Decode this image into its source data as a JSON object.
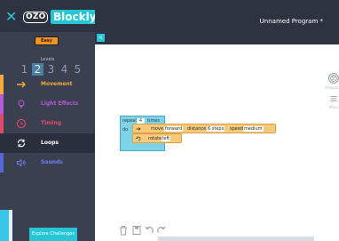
{
  "brand": {
    "x_mark": "✕",
    "ozo": "OZO",
    "blockly": "Blockly"
  },
  "level_badge": "Easy",
  "levels": {
    "label": "Levels",
    "items": [
      "1",
      "2",
      "3",
      "4",
      "5"
    ],
    "active_index": 1
  },
  "nav": [
    {
      "label": "Movement",
      "icon": "arrow-right-icon",
      "color": "#f7a83e"
    },
    {
      "label": "Light Effects",
      "icon": "lightbulb-icon",
      "color": "#b25ad8"
    },
    {
      "label": "Timing",
      "icon": "clock-icon",
      "color": "#e04a6a"
    },
    {
      "label": "Loops",
      "icon": "loop-icon",
      "color": "#25c7d6"
    },
    {
      "label": "Sounds",
      "icon": "speaker-icon",
      "color": "#5566d9"
    }
  ],
  "explore_button": "Explore Challenges",
  "program_title": "Unnamed Program *",
  "collapse_button": "<",
  "blocks": {
    "repeat": {
      "label": "repeat",
      "count": "4",
      "times": "times",
      "do": "do"
    },
    "move": {
      "label": "move",
      "direction": "forward",
      "distance_label": "distance",
      "distance": "6 steps",
      "speed_label": "speed",
      "speed": "medium"
    },
    "rotate": {
      "label": "rotate",
      "direction": "left"
    }
  },
  "right_tools": {
    "program_label": "Program",
    "menu_label": "Menu"
  },
  "bottom_tools": [
    "trash-icon",
    "save-icon",
    "undo-icon",
    "redo-icon"
  ],
  "colors": {
    "accent": "#25c7d6",
    "sidebar": "#3b4050",
    "block_motion": "#f7c97a",
    "block_loop": "#7fd3e8"
  }
}
